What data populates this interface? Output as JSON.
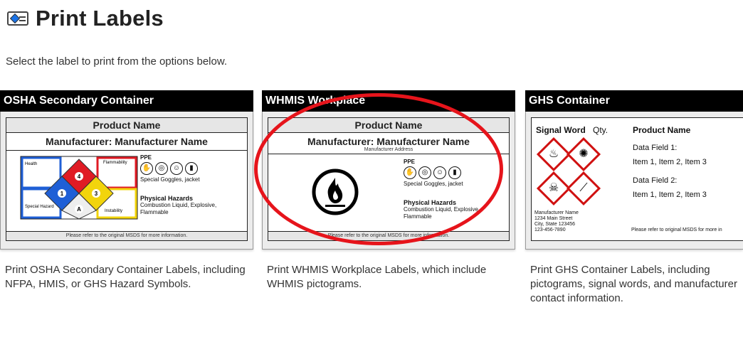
{
  "page": {
    "title": "Print Labels",
    "subtitle": "Select the label to print from the options below.",
    "title_icon": "label-icon"
  },
  "cards": [
    {
      "header": "OSHA Secondary Container",
      "description": "Print OSHA Secondary Container Labels, including NFPA, HMIS, or GHS Hazard Symbols.",
      "label": {
        "product_name": "Product Name",
        "manufacturer": "Manufacturer: Manufacturer Name",
        "nfpa": {
          "health": "Health",
          "flammability": "Flammability",
          "special": "Special Hazard",
          "instability": "Instability",
          "top": "4",
          "left": "1",
          "right": "3",
          "bottom": "A"
        },
        "ppe_title": "PPE",
        "ppe_note": "Special Goggles, jacket",
        "phys_title": "Physical Hazards",
        "phys_text": "Combustion Liquid, Explosive, Flammable",
        "footnote": "Please refer to the original MSDS for more information."
      }
    },
    {
      "header": "WHMIS Workplace",
      "description": "Print WHMIS Workplace Labels, which include WHMIS pictograms.",
      "label": {
        "product_name": "Product Name",
        "manufacturer": "Manufacturer: Manufacturer Name",
        "manufacturer_address": "Manufacturer Address",
        "ppe_title": "PPE",
        "ppe_note": "Special Goggles, jacket",
        "phys_title": "Physical Hazards",
        "phys_text": "Combustion Liquid, Explosive, Flammable",
        "footnote": "Please refer to the original MSDS for more information."
      }
    },
    {
      "header": "GHS Container",
      "description": "Print GHS Container Labels, including pictograms, signal words, and manufacturer contact information.",
      "label": {
        "signal_word": "Signal Word",
        "qty": "Qty.",
        "product_name": "Product Name",
        "field1_title": "Data Field 1:",
        "field1_items": "Item 1, Item 2, Item 3",
        "field2_title": "Data Field 2:",
        "field2_items": "Item 1, Item 2, Item 3",
        "mfr_name": "Manufacturer Name",
        "mfr_street": "1234 Main Street",
        "mfr_city": "City, State 123456",
        "mfr_phone": "123-456-7890",
        "footnote": "Please refer to original MSDS for more in"
      }
    }
  ],
  "colors": {
    "highlight_ring": "#e6141b",
    "header_bg": "#000000",
    "nfpa_health": "#1f5fd6",
    "nfpa_flam": "#e01b24",
    "nfpa_react": "#f2d40c"
  }
}
